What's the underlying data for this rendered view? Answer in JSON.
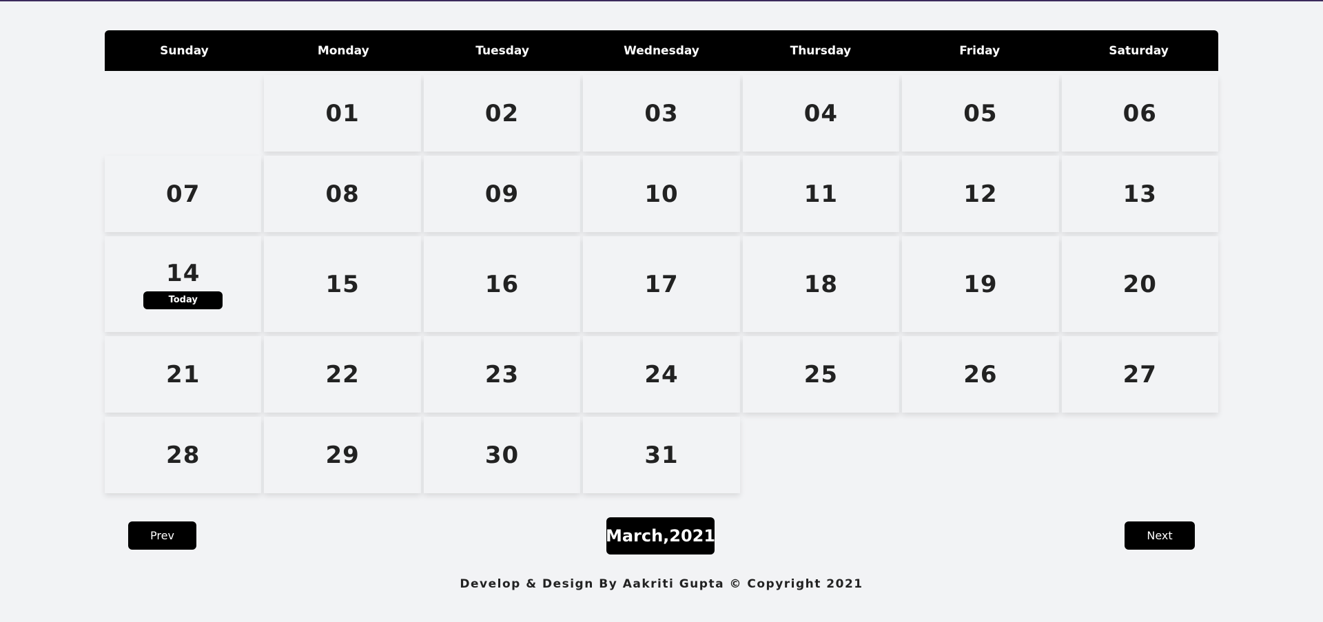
{
  "weekdays": [
    "Sunday",
    "Monday",
    "Tuesday",
    "Wednesday",
    "Thursday",
    "Friday",
    "Saturday"
  ],
  "month_label": "March,2021",
  "start_offset": 1,
  "days": [
    "01",
    "02",
    "03",
    "04",
    "05",
    "06",
    "07",
    "08",
    "09",
    "10",
    "11",
    "12",
    "13",
    "14",
    "15",
    "16",
    "17",
    "18",
    "19",
    "20",
    "21",
    "22",
    "23",
    "24",
    "25",
    "26",
    "27",
    "28",
    "29",
    "30",
    "31"
  ],
  "today": "14",
  "today_label": "Today",
  "controls": {
    "prev_label": "Prev",
    "next_label": "Next"
  },
  "footer": {
    "text": "Develop & Design By Aakriti Gupta © Copyright 2021"
  }
}
